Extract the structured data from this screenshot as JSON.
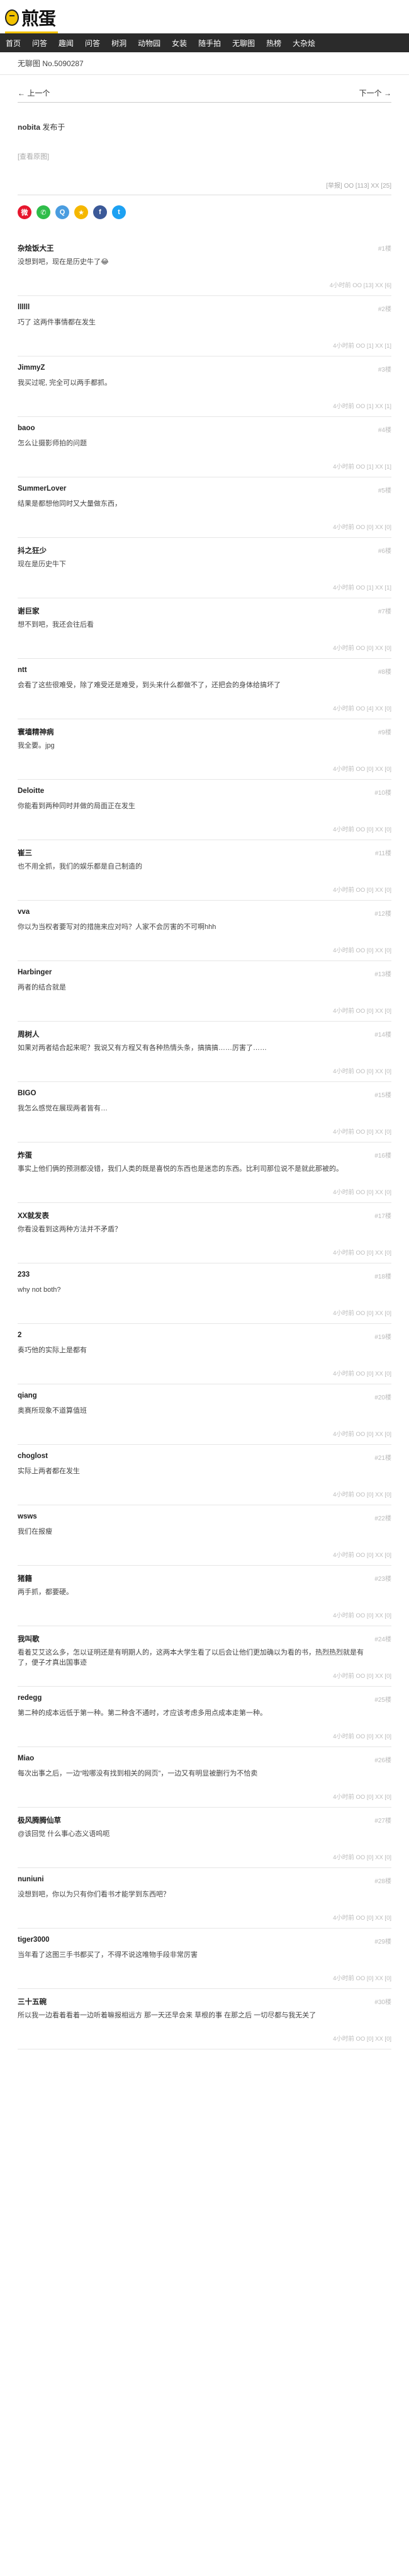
{
  "site": {
    "logo_text": "煎蛋"
  },
  "nav": [
    "首页",
    "问答",
    "趣闻",
    "问答",
    "树洞",
    "动物园",
    "女装",
    "随手拍",
    "无聊图",
    "热榜",
    "大杂烩"
  ],
  "breadcrumb": "无聊图 No.5090287",
  "pager": {
    "prev": "← 上一个",
    "next": "下一个 →"
  },
  "post": {
    "title": "nobita",
    "subtitle": "发布于",
    "body": "[查看原图]",
    "stats": "[举报]  OO [113] XX [25]"
  },
  "share_icons": [
    "weibo-icon",
    "wechat-icon",
    "qq-icon",
    "qzone-icon",
    "facebook-icon",
    "twitter-icon"
  ],
  "comments": [
    {
      "user": "杂烩饭大王",
      "no": "#1楼",
      "text": "没想到吧，现在是历史牛了😂",
      "meta": "4小时前  OO [13] XX [6]"
    },
    {
      "user": "llllll",
      "no": "#2楼",
      "text": "巧了 这两件事情都在发生",
      "meta": "4小时前  OO [1] XX [1]"
    },
    {
      "user": "JimmyZ",
      "no": "#3楼",
      "text": "我买过呢, 完全可以两手都抓。",
      "meta": "4小时前  OO [1] XX [1]"
    },
    {
      "user": "baoo",
      "no": "#4楼",
      "text": "怎么让摄影师拍的问题",
      "meta": "4小时前  OO [1] XX [1]"
    },
    {
      "user": "SummerLover",
      "no": "#5楼",
      "text": "结果是都想他同时又大量做东西，",
      "meta": "4小时前  OO [0] XX [0]"
    },
    {
      "user": "抖之狂少",
      "no": "#6楼",
      "text": "现在是历史牛下",
      "meta": "4小时前  OO [1] XX [1]"
    },
    {
      "user": "谢巨家",
      "no": "#7楼",
      "text": "想不到吧，我还会往后看",
      "meta": "4小时前  OO [0] XX [0]"
    },
    {
      "user": "ntt",
      "no": "#8楼",
      "text": "会看了这些很难受，除了难受还是难受，到头来什么都做不了，还把会的身体给搞坏了",
      "meta": "4小时前  OO [4] XX [0]"
    },
    {
      "user": "寰墙精神病",
      "no": "#9楼",
      "text": "我全要。jpg",
      "meta": "4小时前  OO [0] XX [0]"
    },
    {
      "user": "Deloitte",
      "no": "#10楼",
      "text": "你能看到两种同时并做的局面正在发生",
      "meta": "4小时前  OO [0] XX [0]"
    },
    {
      "user": "崔三",
      "no": "#11楼",
      "text": "也不用全抓，我们的娱乐都是自己制造的",
      "meta": "4小时前  OO [0] XX [0]"
    },
    {
      "user": "vva",
      "no": "#12楼",
      "text": "你以为当权者要写对的措施来应对吗？人家不会厉害的不可啊hhh",
      "meta": "4小时前  OO [0] XX [0]"
    },
    {
      "user": "Harbinger",
      "no": "#13楼",
      "text": "两者的结合就是",
      "meta": "4小时前  OO [0] XX [0]"
    },
    {
      "user": "周树人",
      "no": "#14楼",
      "text": "如果对两者结合起来呢？我说又有方程又有各种热情头条，搞搞搞……厉害了……",
      "meta": "4小时前  OO [0] XX [0]"
    },
    {
      "user": "BIGO",
      "no": "#15楼",
      "text": "我怎么感觉在展现两者皆有…",
      "meta": "4小时前  OO [0] XX [0]"
    },
    {
      "user": "炸蛋",
      "no": "#16楼",
      "text": "事实上他们俩的预测都没错，我们人类的既是喜悦的东西也是迷恋的东西。比利司那位说不是就此那被的。",
      "meta": "4小时前  OO [0] XX [0]"
    },
    {
      "user": "XX就发表",
      "no": "#17楼",
      "text": "你看没看到这两种方法并不矛盾？",
      "meta": "4小时前  OO [0] XX [0]"
    },
    {
      "user": "233",
      "no": "#18楼",
      "text": "why not both?",
      "meta": "4小时前  OO [0] XX [0]"
    },
    {
      "user": "2",
      "no": "#19楼",
      "text": "奏巧他的实际上是都有",
      "meta": "4小时前  OO [0] XX [0]"
    },
    {
      "user": "qiang",
      "no": "#20楼",
      "text": "奥赛所现象不道算值班",
      "meta": "4小时前  OO [0] XX [0]"
    },
    {
      "user": "choglost",
      "no": "#21楼",
      "text": "实际上两者都在发生",
      "meta": "4小时前  OO [0] XX [0]"
    },
    {
      "user": "wsws",
      "no": "#22楼",
      "text": "我们在报瘦",
      "meta": "4小时前  OO [0] XX [0]"
    },
    {
      "user": "猪籍",
      "no": "#23楼",
      "text": "两手抓，都要硬。",
      "meta": "4小时前  OO [0] XX [0]"
    },
    {
      "user": "我叫歌",
      "no": "#24楼",
      "text": "看着艾艾这么多，怎以证明还是有明期人的，这两本大学生看了以后会让他们更加确以为看的书，热烈热烈就是有了，便子才真出国事迹",
      "meta": "4小时前  OO [0] XX [0]"
    },
    {
      "user": "redegg",
      "no": "#25楼",
      "text": "第二种的成本远低于第一种。第二种含不通时，才应该考虑多用点成本走第一种。",
      "meta": "4小时前  OO [0] XX [0]"
    },
    {
      "user": "Miao",
      "no": "#26楼",
      "text": "每次出事之后，一边“啦哪没有找到相关的网页”，一边又有明显被删行为不恰卖",
      "meta": "4小时前  OO [0] XX [0]"
    },
    {
      "user": "极风腾腾仙草",
      "no": "#27楼",
      "text": "@该回觉 什么事心态义语呜呃",
      "meta": "4小时前  OO [0] XX [0]"
    },
    {
      "user": "nuniuni",
      "no": "#28楼",
      "text": "没想到吧，你以为只有你们看书才能学到东西吧？",
      "meta": "4小时前  OO [0] XX [0]"
    },
    {
      "user": "tiger3000",
      "no": "#29楼",
      "text": "当年看了这图三手书都买了，不得不说这唯物手段非常厉害",
      "meta": "4小时前  OO [0] XX [0]"
    },
    {
      "user": "三十五碗",
      "no": "#30楼",
      "text": "所以我一边看着看着一边听着嘛报相远方 那一天还早会来 草根的事 在那之后 一切尽都与我无关了",
      "meta": "4小时前  OO [0] XX [0]"
    }
  ],
  "colors": {
    "accent": "#f2c200",
    "nav_bg": "#2b2b2b",
    "oo": "#d33333",
    "xx": "#336ccc"
  }
}
